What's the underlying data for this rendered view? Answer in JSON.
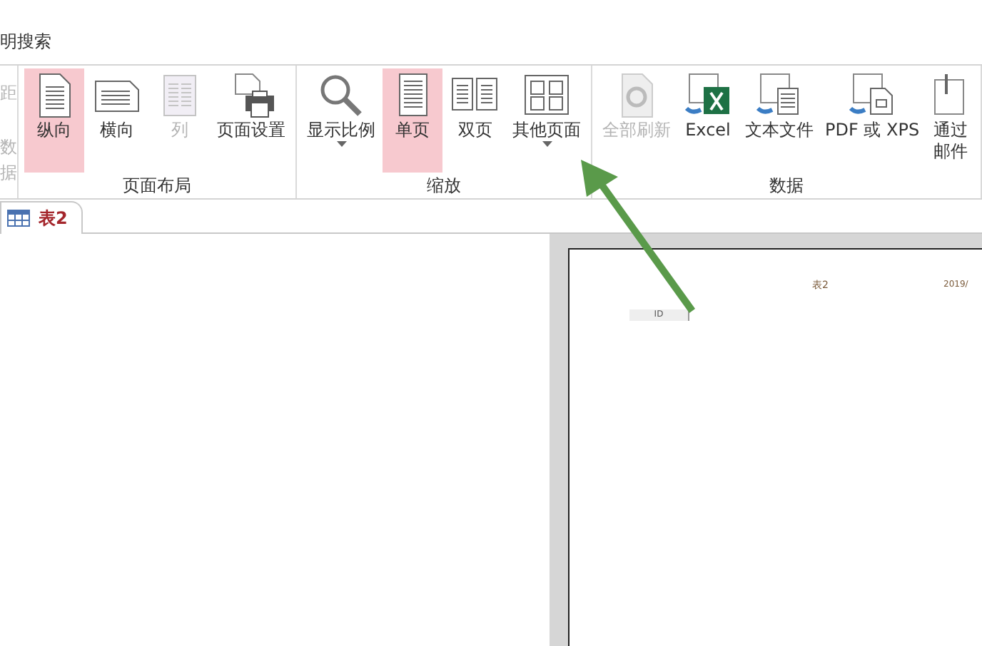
{
  "search_hint": "明搜索",
  "ribbon": {
    "groups": [
      {
        "kind": "partial",
        "items": [
          {
            "label": "距",
            "disabled": true
          },
          {
            "label": "数据",
            "disabled": true
          }
        ]
      },
      {
        "label": "页面布局",
        "kind": "large",
        "items": [
          {
            "label": "纵向",
            "selected": true,
            "disabled": false
          },
          {
            "label": "横向",
            "selected": false,
            "disabled": false
          },
          {
            "label": "列",
            "selected": false,
            "disabled": true
          },
          {
            "label": "页面设置",
            "selected": false,
            "disabled": false
          }
        ]
      },
      {
        "label": "缩放",
        "kind": "large",
        "items": [
          {
            "label": "显示比例",
            "selected": false,
            "disabled": false,
            "dropdown": true
          },
          {
            "label": "单页",
            "selected": true,
            "disabled": false,
            "dropdown": false
          },
          {
            "label": "双页",
            "selected": false,
            "disabled": false,
            "dropdown": false
          },
          {
            "label": "其他页面",
            "selected": false,
            "disabled": false,
            "dropdown": true
          }
        ]
      },
      {
        "label": "数据",
        "kind": "large",
        "items": [
          {
            "label": "全部刷新",
            "selected": false,
            "disabled": true
          },
          {
            "label": "Excel",
            "selected": false,
            "disabled": false
          },
          {
            "label": "文本文件",
            "selected": false,
            "disabled": false
          },
          {
            "label": "PDF 或 XPS",
            "selected": false,
            "disabled": false
          },
          {
            "label": "通过邮件",
            "selected": false,
            "disabled": false
          }
        ]
      }
    ]
  },
  "doc_tabs": [
    {
      "label": "表2",
      "selected": true
    }
  ],
  "preview": {
    "title": "表2",
    "date": "2019/",
    "column_header": "ID"
  }
}
